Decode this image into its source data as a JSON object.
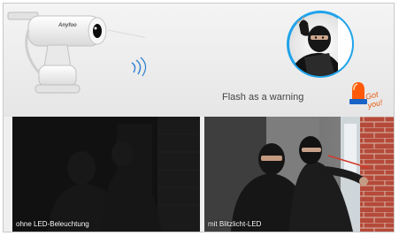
{
  "banner": {
    "warning_caption": "Flash as a warning",
    "alarm_text": "Got you!",
    "camera_brand": "Anyfoo"
  },
  "panels": {
    "left_label": "ohne LED-Beleuchtung",
    "right_label": "mit Blitzlicht-LED"
  },
  "icons": {
    "camera": "ptz-camera-icon",
    "signal": "wireless-signal-icon",
    "alarm": "siren-icon",
    "intruder": "burglar-illustration"
  }
}
